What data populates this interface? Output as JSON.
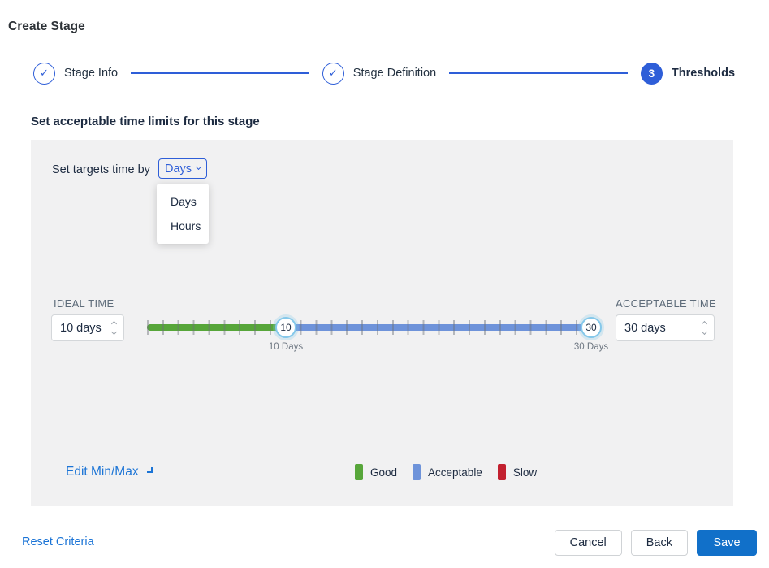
{
  "page": {
    "title": "Create Stage"
  },
  "stepper": {
    "steps": [
      {
        "label": "Stage Info",
        "state": "complete"
      },
      {
        "label": "Stage Definition",
        "state": "complete"
      },
      {
        "label": "Thresholds",
        "state": "current",
        "number": "3"
      }
    ]
  },
  "icons": {
    "check": "✓"
  },
  "section_heading": "Set acceptable time limits for this stage",
  "targets": {
    "label": "Set targets time by",
    "selected": "Days",
    "options": [
      {
        "label": "Days"
      },
      {
        "label": "Hours"
      }
    ]
  },
  "thresholds": {
    "ideal": {
      "label": "IDEAL TIME",
      "value": "10 days"
    },
    "acceptable": {
      "label": "ACCEPTABLE TIME",
      "value": "30 days"
    },
    "slider": {
      "unit": "Days",
      "min_handle": {
        "value": "10",
        "label": "10 Days"
      },
      "max_handle": {
        "value": "30",
        "label": "30 Days"
      }
    },
    "edit_minmax_label": "Edit Min/Max",
    "legend": [
      {
        "label": "Good",
        "color": "#57a63a"
      },
      {
        "label": "Acceptable",
        "color": "#6e93da"
      },
      {
        "label": "Slow",
        "color": "#c2202f"
      }
    ]
  },
  "footer": {
    "reset_label": "Reset Criteria",
    "cancel_label": "Cancel",
    "back_label": "Back",
    "save_label": "Save"
  },
  "colors": {
    "stepper_blue": "#2e5ed8",
    "link_blue": "#1b74d6",
    "save_blue": "#1170c9",
    "good_green": "#57a63a",
    "acceptable_blue": "#6e93da",
    "slow_red": "#c2202f",
    "panel_bg": "#f1f1f2",
    "handle_border": "#85c8ea"
  }
}
